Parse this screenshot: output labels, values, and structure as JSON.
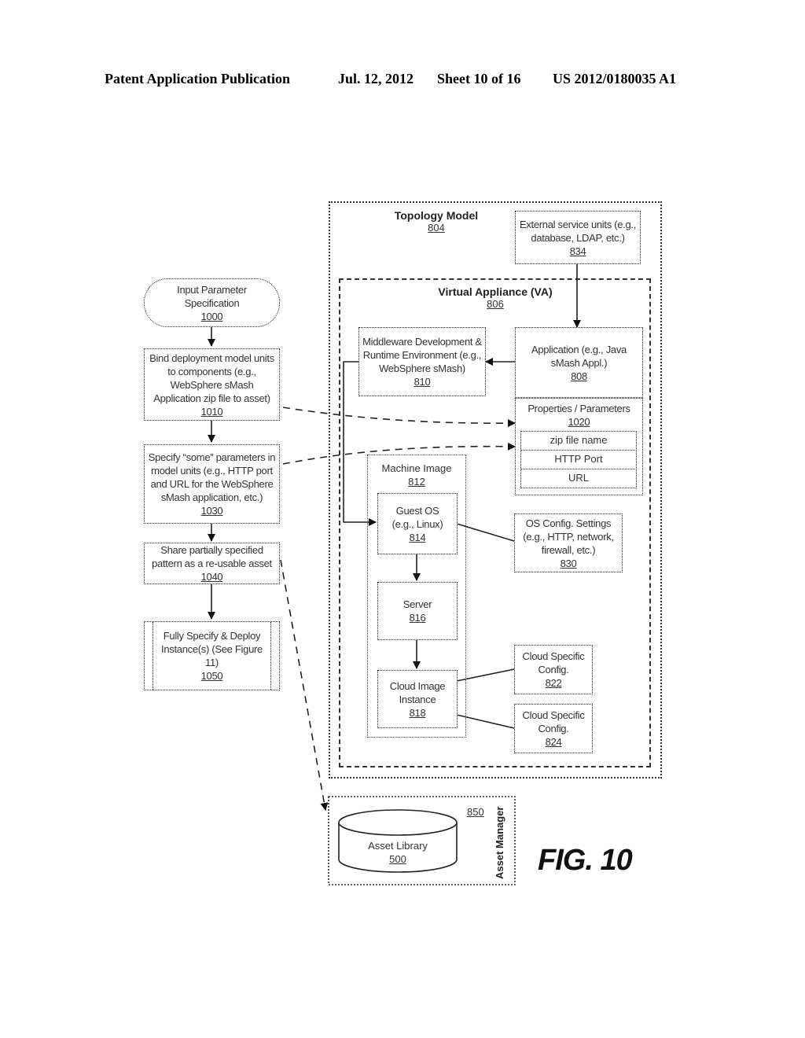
{
  "header": {
    "publication": "Patent Application Publication",
    "date": "Jul. 12, 2012",
    "sheet": "Sheet 10 of 16",
    "number": "US 2012/0180035 A1"
  },
  "flow": {
    "input": {
      "text": "Input Parameter Specification",
      "ref": "1000"
    },
    "bind": {
      "text": "Bind deployment model units to components (e.g., WebSphere sMash Application zip file to asset)",
      "ref": "1010"
    },
    "specify": {
      "text": "Specify “some” parameters in model units (e.g., HTTP port and URL for the WebSphere sMash application, etc.)",
      "ref": "1030"
    },
    "share": {
      "text": "Share partially specified pattern as a re-usable asset",
      "ref": "1040"
    },
    "deploy": {
      "text": "Fully Specify & Deploy Instance(s) (See Figure 11)",
      "ref": "1050"
    }
  },
  "topology": {
    "title": "Topology Model",
    "ref": "804",
    "external": {
      "text": "External service units (e.g., database, LDAP, etc.)",
      "ref": "834"
    },
    "va": {
      "title": "Virtual Appliance (VA)",
      "ref": "806"
    },
    "middleware": {
      "text": "Middleware Development & Runtime Environment (e.g., WebSphere sMash)",
      "ref": "810"
    },
    "application": {
      "text": "Application (e.g., Java sMash Appl.)",
      "ref": "808"
    },
    "properties": {
      "title": "Properties / Parameters",
      "ref": "1020",
      "rows": [
        "zip file name",
        "HTTP Port",
        "URL"
      ]
    },
    "machine_image": {
      "title": "Machine Image",
      "ref": "812"
    },
    "guest_os": {
      "text": "Guest OS (e.g., Linux)",
      "ref": "814"
    },
    "os_config": {
      "text": "OS Config. Settings (e.g., HTTP, network, firewall, etc.)",
      "ref": "830"
    },
    "server": {
      "text": "Server",
      "ref": "816"
    },
    "cloud_image": {
      "text": "Cloud Image Instance",
      "ref": "818"
    },
    "cloud_config_1": {
      "text": "Cloud Specific Config.",
      "ref": "822"
    },
    "cloud_config_2": {
      "text": "Cloud Specific Config.",
      "ref": "824"
    }
  },
  "asset_manager": {
    "title": "Asset Manager",
    "ref": "850",
    "library": {
      "text": "Asset Library",
      "ref": "500"
    }
  },
  "figure_label": "FIG. 10"
}
